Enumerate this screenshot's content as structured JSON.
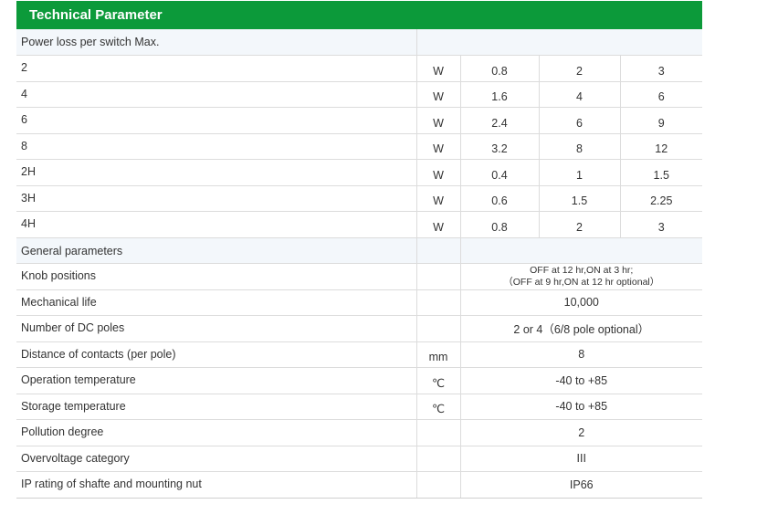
{
  "title": "Technical Parameter",
  "section1": {
    "label": "Power loss per switch Max."
  },
  "power_rows": [
    {
      "label": "2",
      "unit": "W",
      "v1": "0.8",
      "v2": "2",
      "v3": "3"
    },
    {
      "label": "4",
      "unit": "W",
      "v1": "1.6",
      "v2": "4",
      "v3": "6"
    },
    {
      "label": "6",
      "unit": "W",
      "v1": "2.4",
      "v2": "6",
      "v3": "9"
    },
    {
      "label": "8",
      "unit": "W",
      "v1": "3.2",
      "v2": "8",
      "v3": "12"
    },
    {
      "label": "2H",
      "unit": "W",
      "v1": "0.4",
      "v2": "1",
      "v3": "1.5"
    },
    {
      "label": "3H",
      "unit": "W",
      "v1": "0.6",
      "v2": "1.5",
      "v3": "2.25"
    },
    {
      "label": "4H",
      "unit": "W",
      "v1": "0.8",
      "v2": "2",
      "v3": "3"
    }
  ],
  "section2": {
    "label": "General parameters"
  },
  "knob": {
    "label": "Knob positions",
    "line1": "OFF at 12 hr,ON at 3 hr;",
    "line2": "（OFF at 9 hr,ON at 12 hr optional）"
  },
  "general_rows": [
    {
      "label": "Mechanical life",
      "unit": "",
      "value": "10,000"
    },
    {
      "label": "Number of DC poles",
      "unit": "",
      "value": "2 or 4（6/8 pole optional）"
    },
    {
      "label": "Distance of contacts (per pole)",
      "unit": "mm",
      "value": "8"
    },
    {
      "label": "Operation temperature",
      "unit": "℃",
      "value": "-40 to +85"
    },
    {
      "label": "Storage temperature",
      "unit": "℃",
      "value": "-40 to +85"
    },
    {
      "label": "Pollution degree",
      "unit": "",
      "value": "2"
    },
    {
      "label": "Overvoltage category",
      "unit": "",
      "value": "III"
    },
    {
      "label": "IP rating of shafte and mounting nut",
      "unit": "",
      "value": "IP66"
    }
  ]
}
